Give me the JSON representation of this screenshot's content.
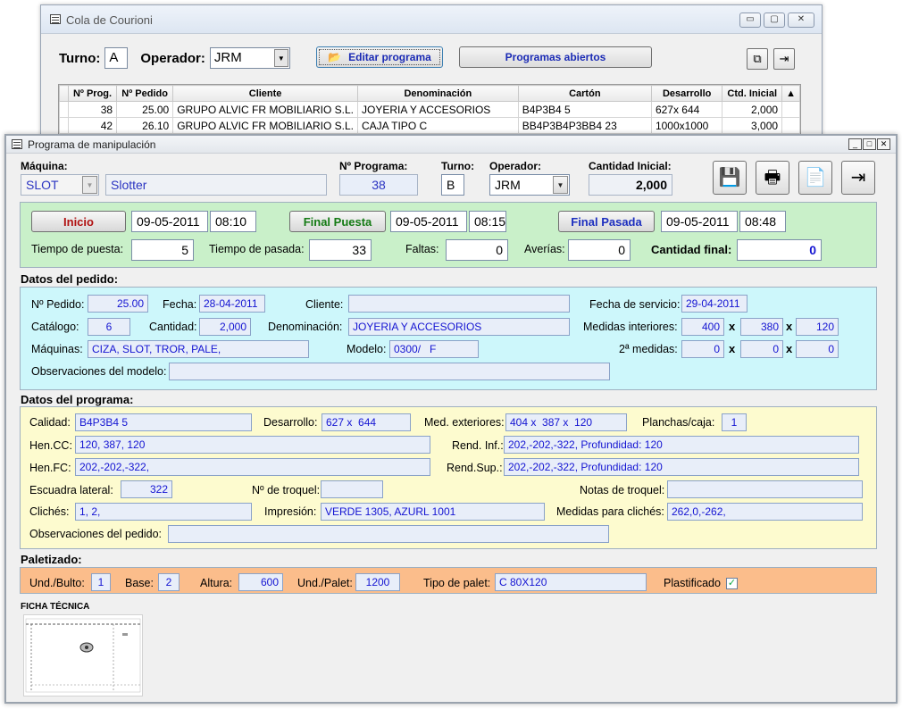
{
  "back_window": {
    "title": "Cola de Courioni",
    "turno_label": "Turno:",
    "turno_value": "A",
    "operador_label": "Operador:",
    "operador_value": "JRM",
    "edit_button": "Editar programa",
    "open_button": "Programas abiertos",
    "columns": [
      "Nº Prog.",
      "Nº Pedido",
      "Cliente",
      "Denominación",
      "Cartón",
      "Desarrollo",
      "Ctd. Inicial"
    ],
    "rows": [
      [
        "38",
        "25.00",
        "GRUPO ALVIC FR MOBILIARIO S.L.",
        "JOYERIA Y ACCESORIOS",
        "B4P3B4 5",
        "627x 644",
        "2,000"
      ],
      [
        "42",
        "26.10",
        "GRUPO ALVIC FR MOBILIARIO S.L.",
        "CAJA TIPO C",
        "BB4P3B4P3BB4 23",
        "1000x1000",
        "3,000"
      ]
    ]
  },
  "front_window": {
    "title": "Programa de manipulación",
    "header": {
      "maquina_label": "Máquina:",
      "maquina_code": "SLOT",
      "maquina_name": "Slotter",
      "nprograma_label": "Nº Programa:",
      "nprograma_value": "38",
      "turno_label": "Turno:",
      "turno_value": "B",
      "operador_label": "Operador:",
      "operador_value": "JRM",
      "cantidad_label": "Cantidad Inicial:",
      "cantidad_value": "2,000"
    },
    "timing": {
      "inicio_button": "Inicio",
      "inicio_date": "09-05-2011",
      "inicio_time": "08:10",
      "final_puesta_button": "Final Puesta",
      "puesta_date": "09-05-2011",
      "puesta_time": "08:15",
      "final_pasada_button": "Final Pasada",
      "pasada_date": "09-05-2011",
      "pasada_time": "08:48",
      "tiempo_puesta_label": "Tiempo de puesta:",
      "tiempo_puesta_value": "5",
      "tiempo_pasada_label": "Tiempo de pasada:",
      "tiempo_pasada_value": "33",
      "faltas_label": "Faltas:",
      "faltas_value": "0",
      "averias_label": "Averías:",
      "averias_value": "0",
      "cantidad_final_label": "Cantidad final:",
      "cantidad_final_value": "0"
    },
    "pedido": {
      "section_title": "Datos del pedido:",
      "npedido_label": "Nº Pedido:",
      "npedido_value": "25.00",
      "fecha_label": "Fecha:",
      "fecha_value": "28-04-2011",
      "cliente_label": "Cliente:",
      "cliente_value": "",
      "fecha_servicio_label": "Fecha de servicio:",
      "fecha_servicio_value": "29-04-2011",
      "catalogo_label": "Catálogo:",
      "catalogo_value": "6",
      "cantidad_label": "Cantidad:",
      "cantidad_value": "2,000",
      "denominacion_label": "Denominación:",
      "denominacion_value": "JOYERIA Y ACCESORIOS",
      "medidas_int_label": "Medidas interiores:",
      "medidas_int": [
        "400",
        "380",
        "120"
      ],
      "maquinas_label": "Máquinas:",
      "maquinas_value": "CIZA, SLOT, TROR, PALE,",
      "modelo_label": "Modelo:",
      "modelo_value": "0300/   F",
      "medidas2_label": "2ª medidas:",
      "medidas2": [
        "0",
        "0",
        "0"
      ],
      "x_sep": "x",
      "obs_modelo_label": "Observaciones del modelo:",
      "obs_modelo_value": ""
    },
    "programa": {
      "section_title": "Datos del programa:",
      "calidad_label": "Calidad:",
      "calidad_value": "B4P3B4 5",
      "desarrollo_label": "Desarrollo:",
      "desarrollo_value": "627 x  644",
      "med_ext_label": "Med. exteriores:",
      "med_ext_value": "404 x  387 x  120",
      "planchas_label": "Planchas/caja:",
      "planchas_value": "1",
      "hencc_label": "Hen.CC:",
      "hencc_value": "120, 387, 120",
      "rend_inf_label": "Rend. Inf.:",
      "rend_inf_value": "202,-202,-322, Profundidad: 120",
      "henfc_label": "Hen.FC:",
      "henfc_value": "202,-202,-322,",
      "rend_sup_label": "Rend.Sup.:",
      "rend_sup_value": "202,-202,-322, Profundidad: 120",
      "escuadra_label": "Escuadra lateral:",
      "escuadra_value": "322",
      "troquel_label": "Nº de troquel:",
      "troquel_value": "",
      "notas_troquel_label": "Notas de troquel:",
      "notas_troquel_value": "",
      "cliches_label": "Clichés:",
      "cliches_value": "1, 2,",
      "impresion_label": "Impresión:",
      "impresion_value": "VERDE 1305, AZURL 1001",
      "medidas_cliches_label": "Medidas para clichés:",
      "medidas_cliches_value": "262,0,-262,",
      "obs_pedido_label": "Observaciones del pedido:",
      "obs_pedido_value": ""
    },
    "paletizado": {
      "section_title": "Paletizado:",
      "und_bulto_label": "Und./Bulto:",
      "und_bulto_value": "1",
      "base_label": "Base:",
      "base_value": "2",
      "altura_label": "Altura:",
      "altura_value": "600",
      "und_palet_label": "Und./Palet:",
      "und_palet_value": "1200",
      "tipo_palet_label": "Tipo de palet:",
      "tipo_palet_value": "C 80X120",
      "plastificado_label": "Plastificado",
      "plastificado_checked": true
    },
    "ficha_label": "FICHA TÉCNICA"
  }
}
